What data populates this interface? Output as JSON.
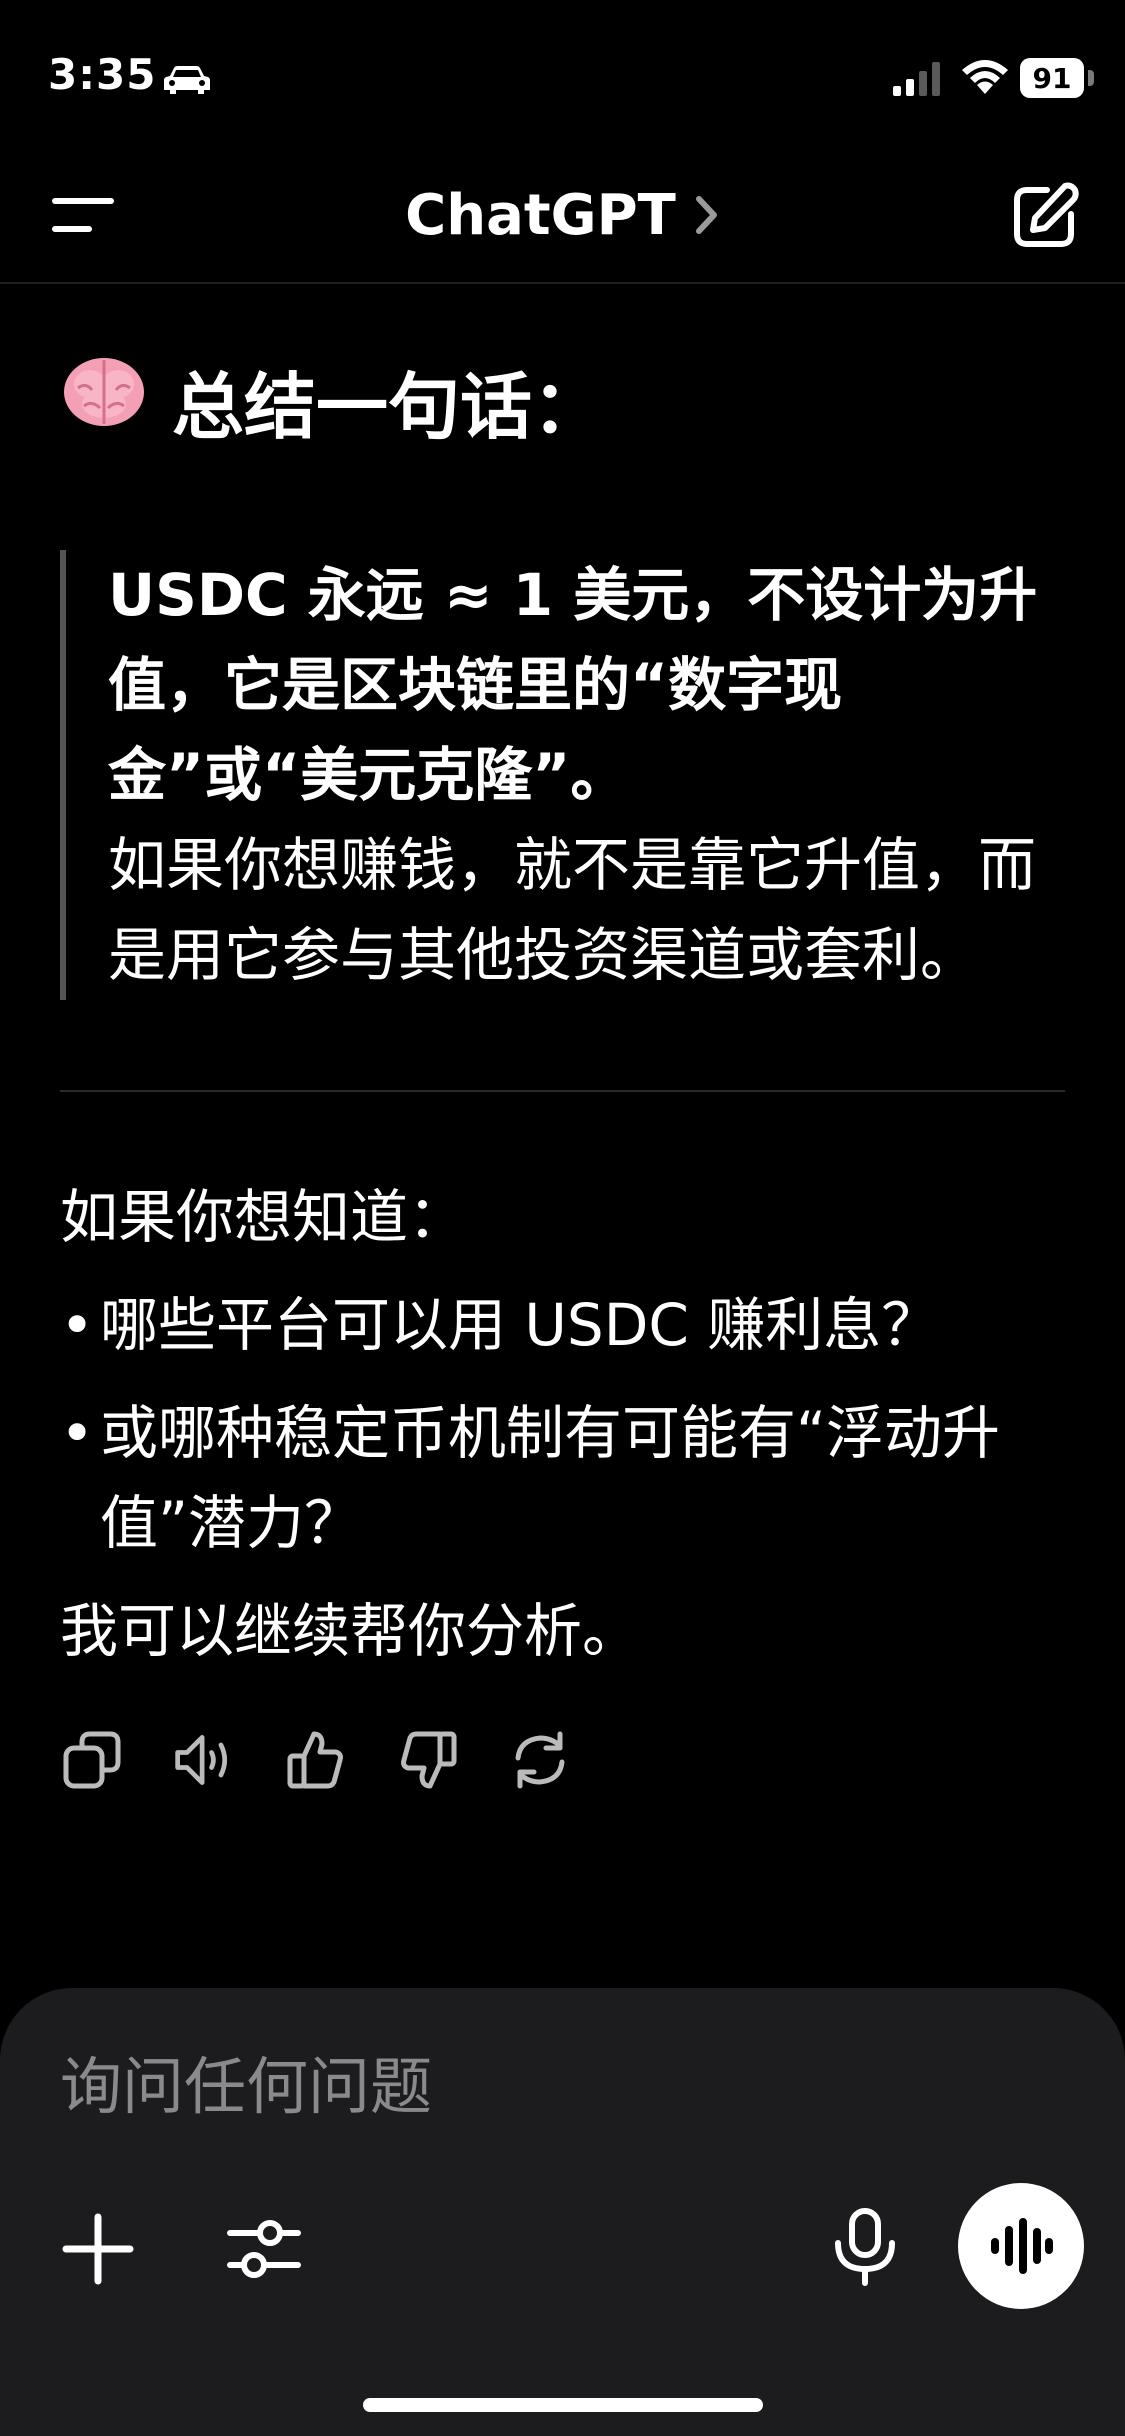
{
  "status_bar": {
    "time": "3:35",
    "battery": "91"
  },
  "nav": {
    "title": "ChatGPT"
  },
  "message": {
    "heading": "总结一句话：",
    "quote_bold": "USDC 永远 ≈ 1 美元，不设计为升值，它是区块链里的“数字现金”或“美元克隆”。",
    "quote_normal": "如果你想赚钱，就不是靠它升值，而是用它参与其他投资渠道或套利。",
    "followup_intro": "如果你想知道：",
    "followup_items": [
      "哪些平台可以用 USDC 赚利息？",
      "或哪种稳定币机制有可能有“浮动升值”潜力？"
    ],
    "followup_outro": "我可以继续帮你分析。",
    "bullet": "•"
  },
  "composer": {
    "placeholder": "询问任何问题"
  },
  "icons": {
    "status": [
      "car-icon",
      "signal-icon",
      "wifi-icon",
      "battery-icon"
    ],
    "nav": [
      "menu-icon",
      "chevron-right-icon",
      "compose-icon"
    ],
    "actions": [
      "copy-icon",
      "speaker-icon",
      "thumbs-up-icon",
      "thumbs-down-icon",
      "regenerate-icon"
    ],
    "composer": [
      "plus-icon",
      "sliders-icon",
      "microphone-icon",
      "voice-waveform-icon"
    ]
  },
  "colors": {
    "background": "#000000",
    "text": "#ffffff",
    "composer_bg": "#1c1c1e",
    "placeholder": "#8a8a8e",
    "quote_border": "#555555"
  }
}
